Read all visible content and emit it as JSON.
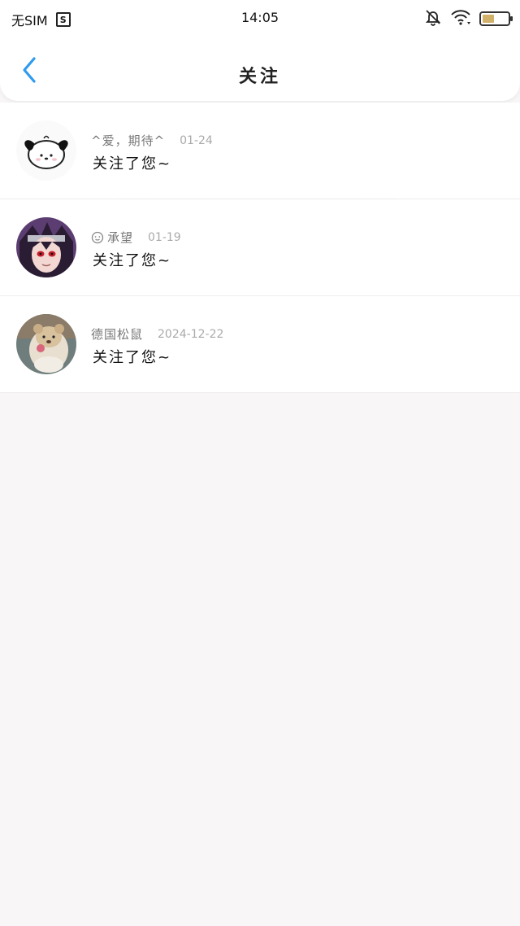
{
  "status_bar": {
    "carrier": "无SIM",
    "sim_icon_letter": "S",
    "time": "14:05",
    "battery_level": 0.45,
    "icons": [
      "sim-icon",
      "mute-bell-icon",
      "wifi-icon",
      "battery-icon"
    ]
  },
  "nav": {
    "back_icon": "chevron-left-icon",
    "title": "关注"
  },
  "notifications": [
    {
      "name": "^爱，期待^",
      "date": "01-24",
      "message": "关注了您~",
      "avatar": "dog-avatar"
    },
    {
      "name": "承望",
      "date": "01-19",
      "message": "关注了您~",
      "avatar": "anime-avatar",
      "name_icon": "smile-icon"
    },
    {
      "name": "德国松鼠",
      "date": "2024-12-22",
      "message": "关注了您~",
      "avatar": "bear-avatar"
    }
  ],
  "colors": {
    "accent": "#2f9bef",
    "background": "#f8f6f7"
  }
}
